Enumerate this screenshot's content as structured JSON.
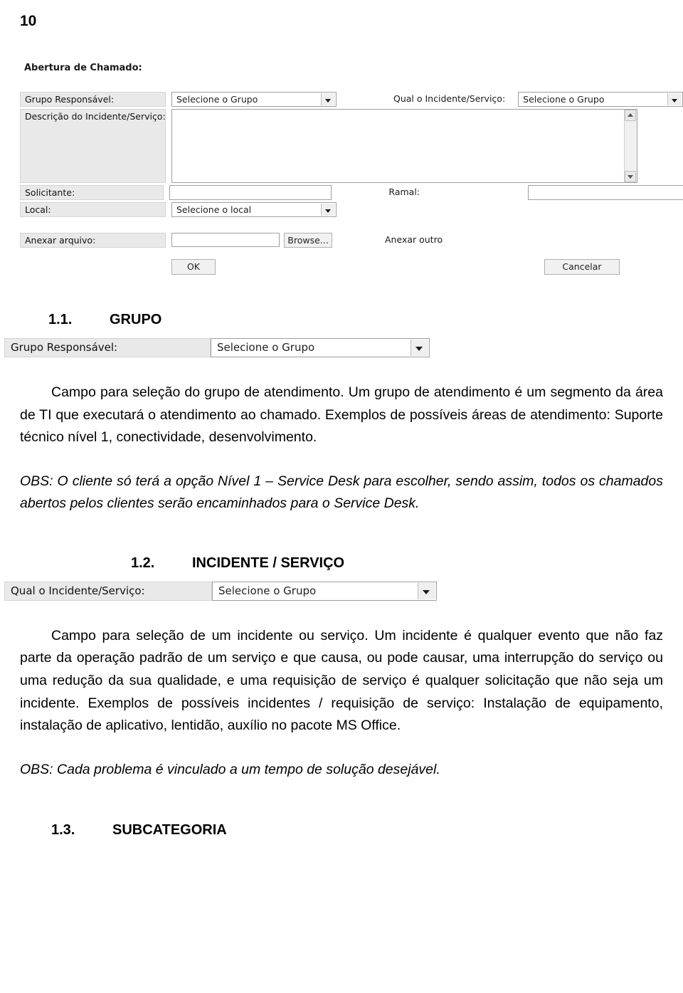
{
  "page": {
    "number": "10"
  },
  "form": {
    "title": "Abertura de Chamado:",
    "group_label": "Grupo Responsável:",
    "group_select_value": "Selecione o Grupo",
    "incident_label": "Qual o Incidente/Serviço:",
    "incident_select_value": "Selecione o Grupo",
    "description_label": "Descrição do Incidente/Serviço:",
    "description_value": "",
    "requester_label": "Solicitante:",
    "requester_value": "",
    "extension_label": "Ramal:",
    "extension_value": "",
    "local_label": "Local:",
    "local_select_value": "Selecione o local",
    "attach_label": "Anexar arquivo:",
    "attach_value": "",
    "browse_button": "Browse...",
    "attach_other_label": "Anexar outro",
    "ok_button": "OK",
    "cancel_button": "Cancelar"
  },
  "sections": [
    {
      "number": "1.1.",
      "title": "GRUPO",
      "field_label": "Grupo Responsável:",
      "field_value": "Selecione o Grupo",
      "paragraph": "Campo para seleção do grupo de atendimento. Um grupo de atendimento é um segmento da área de TI que executará o atendimento ao chamado. Exemplos de possíveis áreas de atendimento: Suporte técnico nível 1, conectividade, desenvolvimento.",
      "obs": "OBS: O cliente só terá a opção Nível 1 – Service Desk para escolher, sendo assim, todos os chamados abertos pelos clientes serão encaminhados para o Service Desk."
    },
    {
      "number": "1.2.",
      "title": "INCIDENTE / SERVIÇO",
      "field_label": "Qual o Incidente/Serviço:",
      "field_value": "Selecione o Grupo",
      "paragraph": "Campo para seleção de um incidente ou serviço. Um incidente é qualquer evento que não faz parte da operação padrão de um serviço e que causa, ou pode causar, uma interrupção do serviço ou uma redução da sua qualidade, e uma requisição de serviço é qualquer solicitação que não seja um incidente. Exemplos de possíveis incidentes / requisição de serviço: Instalação de equipamento, instalação de aplicativo, lentidão, auxílio no pacote MS Office.",
      "obs": "OBS: Cada problema é vinculado a um tempo de solução desejável."
    },
    {
      "number": "1.3.",
      "title": "SUBCATEGORIA"
    }
  ]
}
